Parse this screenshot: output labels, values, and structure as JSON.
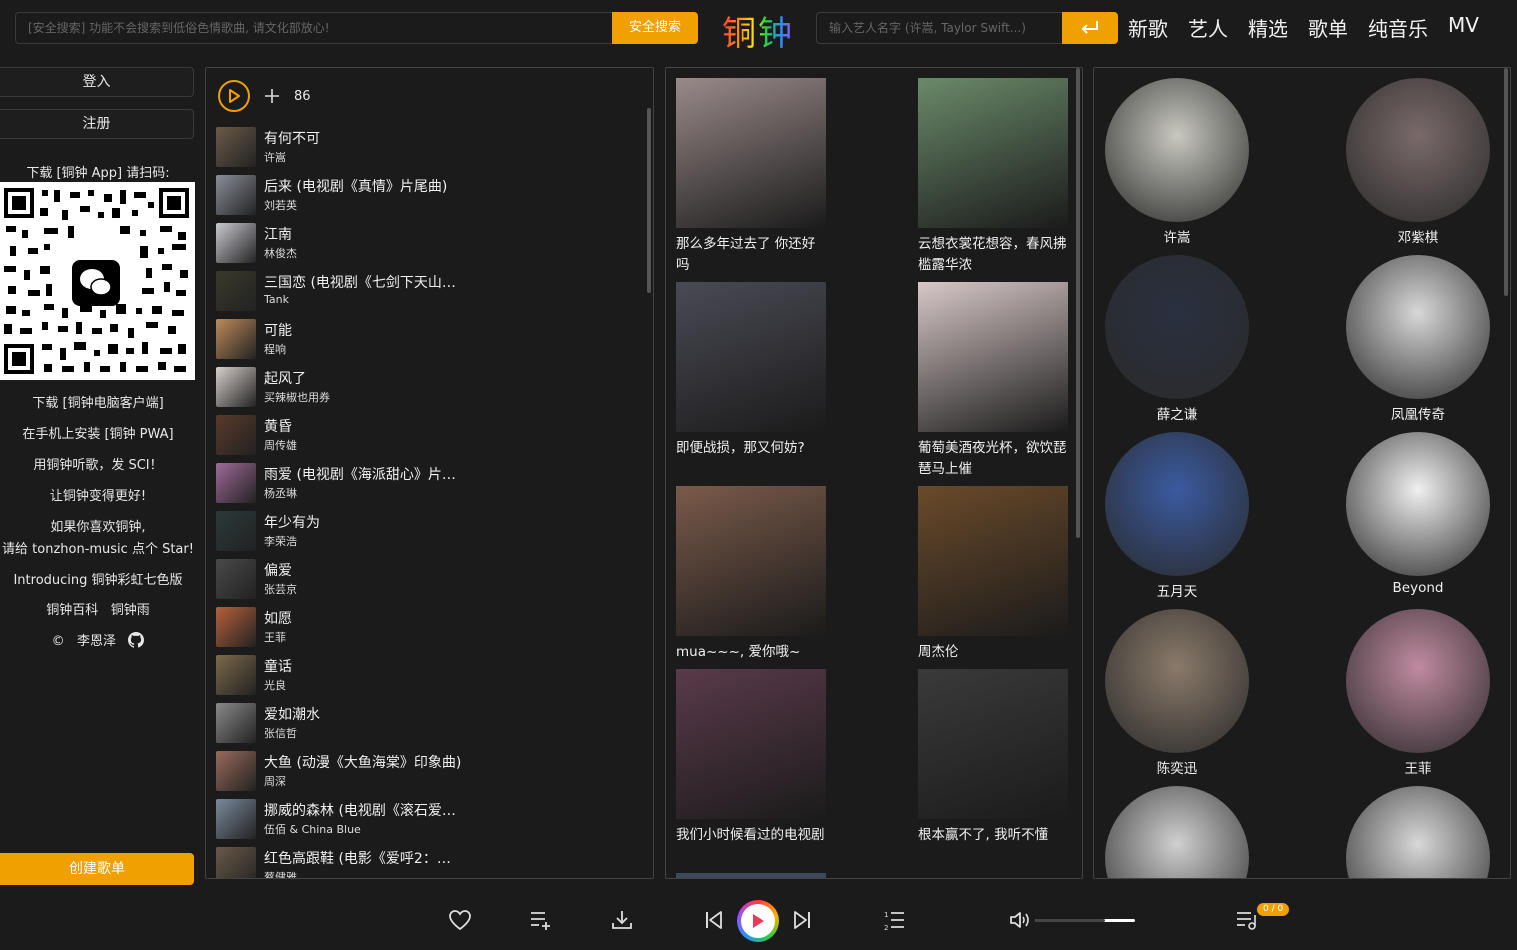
{
  "header": {
    "safe_search_placeholder": "[安全搜索] 功能不会搜索到低俗色情歌曲, 请文化部放心!",
    "safe_search_button": "安全搜索",
    "logo": "铜钟",
    "artist_search_placeholder": "输入艺人名字 (许嵩, Taylor Swift...)",
    "nav": [
      "新歌",
      "艺人",
      "精选",
      "歌单",
      "纯音乐",
      "MV"
    ]
  },
  "sidebar": {
    "login": "登入",
    "register": "注册",
    "download_app": "下载 [铜钟 App] 请扫码:",
    "download_pc": "下载 [铜钟电脑客户端]",
    "install_pwa": "在手机上安装 [铜钟 PWA]",
    "sci": "用铜钟听歌，发 SCI！",
    "better": "让铜钟变得更好!",
    "like_line1": "如果你喜欢铜钟,",
    "like_line2": "请给 tonzhon-music 点个 Star!",
    "introducing": "Introducing 铜钟彩虹七色版",
    "wiki": "铜钟百科",
    "rain": "铜钟雨",
    "copyright": "©",
    "author": "李恩泽",
    "create_playlist": "创建歌单"
  },
  "song_list": {
    "count": "86",
    "songs": [
      {
        "title": "有何不可",
        "artist": "许嵩",
        "color": "#6b5a4a"
      },
      {
        "title": "后来 (电视剧《真情》片尾曲)",
        "artist": "刘若英",
        "color": "#8a8f99"
      },
      {
        "title": "江南",
        "artist": "林俊杰",
        "color": "#c9c9d1"
      },
      {
        "title": "三国恋 (电视剧《七剑下天山》…",
        "artist": "Tank",
        "color": "#3a3a2a"
      },
      {
        "title": "可能",
        "artist": "程响",
        "color": "#c08a5a"
      },
      {
        "title": "起风了",
        "artist": "买辣椒也用券",
        "color": "#d8d0cc"
      },
      {
        "title": "黄昏",
        "artist": "周传雄",
        "color": "#5a3a2a"
      },
      {
        "title": "雨爱 (电视剧《海派甜心》片尾…",
        "artist": "杨丞琳",
        "color": "#a06a9a"
      },
      {
        "title": "年少有为",
        "artist": "李荣浩",
        "color": "#2a3a3a"
      },
      {
        "title": "偏爱",
        "artist": "张芸京",
        "color": "#4a4a4a"
      },
      {
        "title": "如愿",
        "artist": "王菲",
        "color": "#b8603a"
      },
      {
        "title": "童话",
        "artist": "光良",
        "color": "#7a6a4a"
      },
      {
        "title": "爱如潮水",
        "artist": "张信哲",
        "color": "#8a8a8a"
      },
      {
        "title": "大鱼 (动漫《大鱼海棠》印象曲)",
        "artist": "周深",
        "color": "#9a6a5a"
      },
      {
        "title": "挪威的森林 (电视剧《滚石爱情…",
        "artist": "伍佰 & China Blue",
        "color": "#7a8a9a"
      },
      {
        "title": "红色高跟鞋 (电影《爱呼2：爱…",
        "artist": "蔡健雅",
        "color": "#6a5a4a"
      }
    ]
  },
  "playlists": [
    {
      "title": "那么多年过去了 你还好吗",
      "color": "#9a8a8a"
    },
    {
      "title": "云想衣裳花想容，春风拂槛露华浓",
      "color": "#6a8a6a"
    },
    {
      "title": "即便战损，那又何妨?",
      "color": "#4a4a55"
    },
    {
      "title": "葡萄美酒夜光杯，欲饮琵琶马上催",
      "color": "#d8c8c8"
    },
    {
      "title": "mua~~~, 爱你哦~",
      "color": "#7a5a4a"
    },
    {
      "title": "周杰伦",
      "color": "#6a4a2a"
    },
    {
      "title": "我们小时候看过的电视剧",
      "color": "#5a3a4a"
    },
    {
      "title": "根本赢不了, 我听不懂",
      "color": "#3a3a3a"
    }
  ],
  "artists": [
    {
      "name": "许嵩",
      "color": "#c8c8c0"
    },
    {
      "name": "邓紫棋",
      "color": "#7a6a6a"
    },
    {
      "name": "薛之谦",
      "color": "#2a3040"
    },
    {
      "name": "凤凰传奇",
      "color": "#d8d8d8"
    },
    {
      "name": "五月天",
      "color": "#3a5aa0"
    },
    {
      "name": "Beyond",
      "color": "#f0f0f0"
    },
    {
      "name": "陈奕迅",
      "color": "#8a7a6a"
    },
    {
      "name": "王菲",
      "color": "#c08aa0"
    },
    {
      "name": "",
      "color": "#d0d0d0"
    },
    {
      "name": "",
      "color": "#d8d8d8"
    }
  ],
  "player": {
    "queue_badge": "0 / 0",
    "volume_level": 0.7
  },
  "colors": {
    "accent": "#f0a000",
    "background": "#1b1b1b"
  }
}
